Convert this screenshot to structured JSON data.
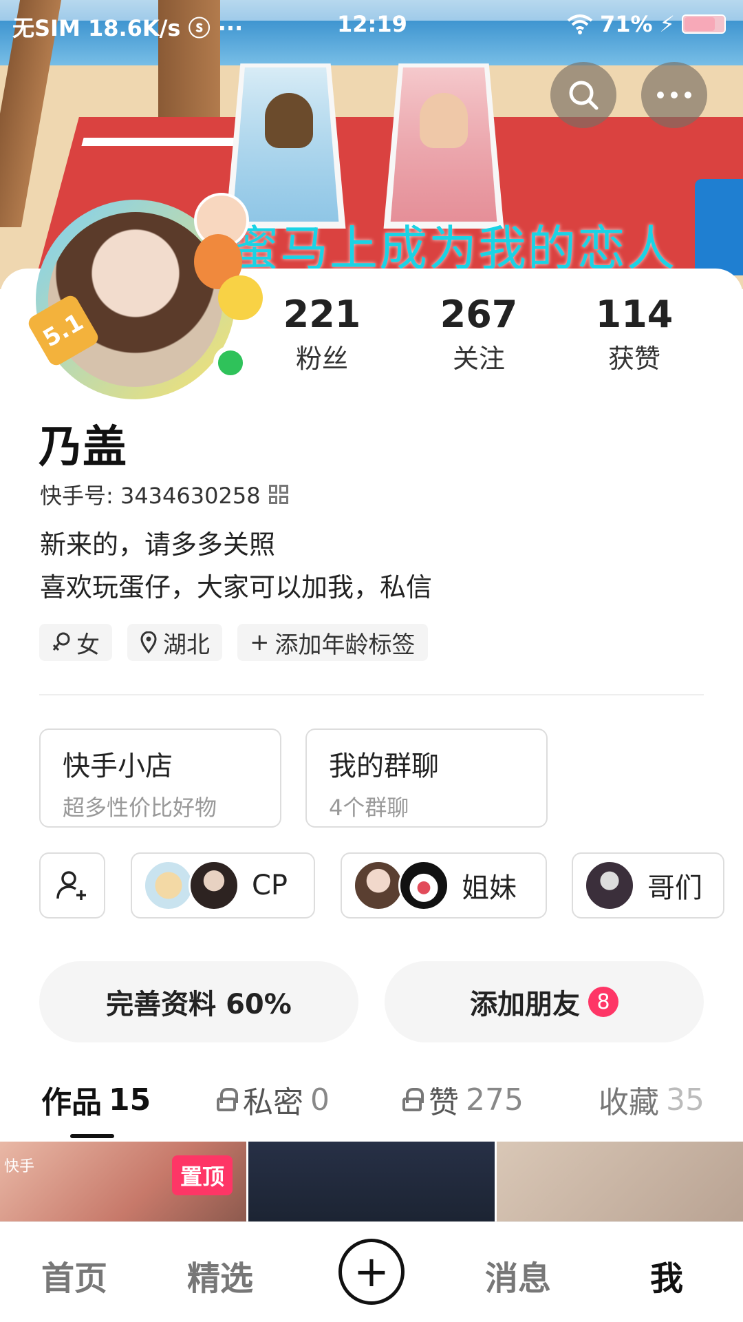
{
  "status_bar": {
    "left": "无SIM 18.6K/s ⓢ ···",
    "time": "12:19",
    "battery": "71%"
  },
  "banner": {
    "text": "蜜马上成为我的恋人"
  },
  "avatar_badge": "5.1",
  "stats": [
    {
      "num": "221",
      "label": "粉丝"
    },
    {
      "num": "267",
      "label": "关注"
    },
    {
      "num": "114",
      "label": "获赞"
    }
  ],
  "profile": {
    "name": "乃盖",
    "kuaishou_id": "快手号: 3434630258",
    "bio_line1": "新来的，请多多关照",
    "bio_line2": "喜欢玩蛋仔，大家可以加我，私信"
  },
  "tags": {
    "gender": "女",
    "location": "湖北",
    "add_age": "添加年龄标签"
  },
  "features": {
    "shop_title": "快手小店",
    "shop_sub": "超多性价比好物",
    "group_title": "我的群聊",
    "group_sub": "4个群聊"
  },
  "relations": {
    "cp": "CP",
    "sisters": "姐妹",
    "brothers": "哥们"
  },
  "actions": {
    "complete": "完善资料 60%",
    "add_friend": "添加朋友",
    "add_friend_badge": "8"
  },
  "tabs": {
    "works": "作品",
    "works_count": "15",
    "private": "私密",
    "private_count": "0",
    "liked": "赞",
    "liked_count": "275",
    "fav": "收藏",
    "fav_count": "35"
  },
  "thumbs": {
    "pin_label": "置顶",
    "t1_text": "快手"
  },
  "bottom_nav": {
    "home": "首页",
    "select": "精选",
    "plus": "+",
    "message": "消息",
    "me": "我"
  }
}
